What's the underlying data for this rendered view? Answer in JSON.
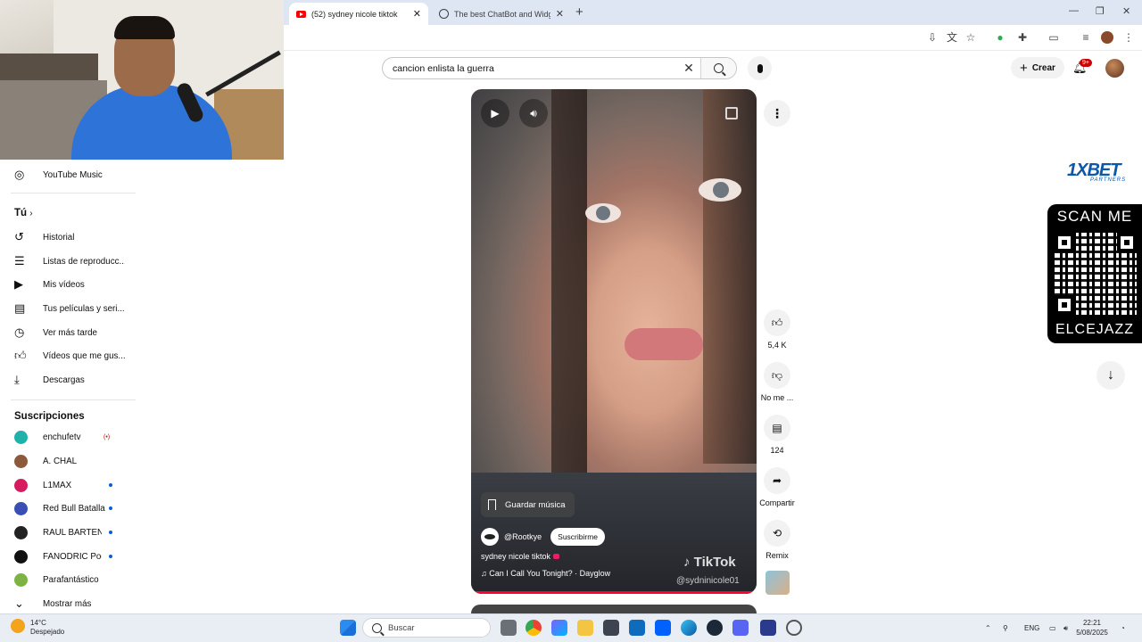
{
  "browser": {
    "tabs": [
      {
        "title": "(52) sydney nicole tiktok",
        "active": true
      },
      {
        "title": "The best ChatBot and Widgets",
        "active": false
      }
    ],
    "new_tab": "+",
    "close_glyph": "✕"
  },
  "youtube": {
    "search": {
      "query": "cancion enlista la guerra"
    },
    "create_label": "Crear",
    "notification_count": "9+"
  },
  "sidebar": {
    "music": "YouTube Music",
    "you_header": "Tú",
    "you_items": [
      {
        "label": "Historial",
        "icon": "history-icon"
      },
      {
        "label": "Listas de reproducc...",
        "icon": "playlist-icon"
      },
      {
        "label": "Mis vídeos",
        "icon": "video-icon"
      },
      {
        "label": "Tus películas y seri...",
        "icon": "film-icon"
      },
      {
        "label": "Ver más tarde",
        "icon": "clock-icon"
      },
      {
        "label": "Vídeos que me gus...",
        "icon": "thumb-up-icon"
      },
      {
        "label": "Descargas",
        "icon": "download-icon"
      }
    ],
    "subs_header": "Suscripciones",
    "subscriptions": [
      {
        "name": "enchufetv",
        "indicator": "(•)",
        "color": "#20b2aa"
      },
      {
        "name": "A. CHAL",
        "indicator": "",
        "color": "#8b5a3c"
      },
      {
        "name": "L1MAX",
        "indicator": "•",
        "color": "#d81b60"
      },
      {
        "name": "Red Bull Batalla",
        "indicator": "•",
        "color": "#3a4fb5"
      },
      {
        "name": "RAUL BARTENDER",
        "indicator": "•",
        "color": "#222222"
      },
      {
        "name": "FANODRIC Podc...",
        "indicator": "•",
        "color": "#111111"
      },
      {
        "name": "Parafantástico",
        "indicator": "",
        "color": "#7cb342"
      }
    ],
    "show_more": "Mostrar más"
  },
  "short": {
    "save_music": "Guardar música",
    "channel": "@Rootkye",
    "subscribe": "Suscribirme",
    "title": "sydney nicole tiktok",
    "music": "Can I Call You Tonight? · Dayglow",
    "watermark": "TikTok",
    "watermark_user": "@sydninicole01",
    "progress": 1.0
  },
  "actions": {
    "like_count": "5,4 K",
    "dislike": "No me ...",
    "comments": "124",
    "share": "Compartir",
    "remix": "Remix"
  },
  "overlay": {
    "brand": "1XBET",
    "brand_sub": "PARTNERS",
    "scan": "SCAN ME",
    "code": "ELCEJAZZ"
  },
  "taskbar": {
    "temp": "14°C",
    "weather": "Despejado",
    "search": "Buscar",
    "lang": "ENG",
    "time": "22:21",
    "date": "5/08/2025"
  }
}
